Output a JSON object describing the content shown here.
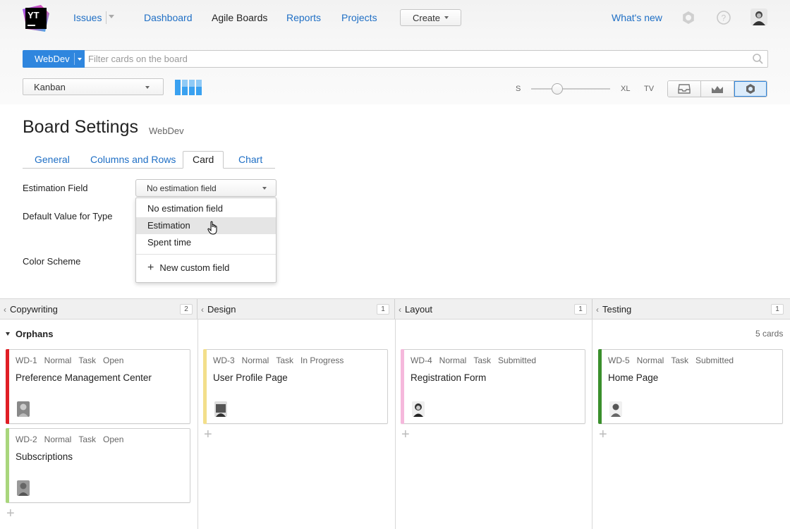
{
  "nav": {
    "logo_text": "YT",
    "issues": "Issues",
    "dashboard": "Dashboard",
    "agile_boards": "Agile Boards",
    "reports": "Reports",
    "projects": "Projects",
    "create": "Create",
    "whats_new": "What's new",
    "icons": [
      "gear-icon",
      "help-icon",
      "user-avatar"
    ]
  },
  "search": {
    "project": "WebDev",
    "placeholder": "Filter cards on the board"
  },
  "board": {
    "selected": "Kanban",
    "size_labels": [
      "S",
      "XL",
      "TV"
    ],
    "size_level": 0.3,
    "view_buttons": [
      "inbox-icon",
      "chart-icon",
      "settings-icon"
    ],
    "accent": "#2f86de"
  },
  "settings": {
    "title": "Board Settings",
    "project": "WebDev",
    "tabs": [
      "General",
      "Columns and Rows",
      "Card",
      "Chart"
    ],
    "active_tab": "Card",
    "estimation_label": "Estimation Field",
    "estimation_value": "No estimation field",
    "default_value_label": "Default Value for Type",
    "color_scheme_label": "Color Scheme",
    "dropdown": {
      "options": [
        "No estimation field",
        "Estimation",
        "Spent time"
      ],
      "highlighted": "Estimation",
      "new_field": "New custom field"
    }
  },
  "columns": [
    {
      "name": "Copywriting",
      "count": "2"
    },
    {
      "name": "Design",
      "count": "1"
    },
    {
      "name": "Layout",
      "count": "1"
    },
    {
      "name": "Testing",
      "count": "1"
    }
  ],
  "swimlane": {
    "name": "Orphans",
    "count": "5 cards"
  },
  "cards": [
    {
      "id": "WD-1",
      "priority": "Normal",
      "type": "Task",
      "state": "Open",
      "summary": "Preference Management Center",
      "color": "#e01e25"
    },
    {
      "id": "WD-2",
      "priority": "Normal",
      "type": "Task",
      "state": "Open",
      "summary": "Subscriptions",
      "color": "#a9d67c"
    },
    {
      "id": "WD-3",
      "priority": "Normal",
      "type": "Task",
      "state": "In Progress",
      "summary": "User Profile Page",
      "color": "#f3df8a"
    },
    {
      "id": "WD-4",
      "priority": "Normal",
      "type": "Task",
      "state": "Submitted",
      "summary": "Registration Form",
      "color": "#f5b8dc"
    },
    {
      "id": "WD-5",
      "priority": "Normal",
      "type": "Task",
      "state": "Submitted",
      "summary": "Home Page",
      "color": "#3a8f2c"
    }
  ]
}
